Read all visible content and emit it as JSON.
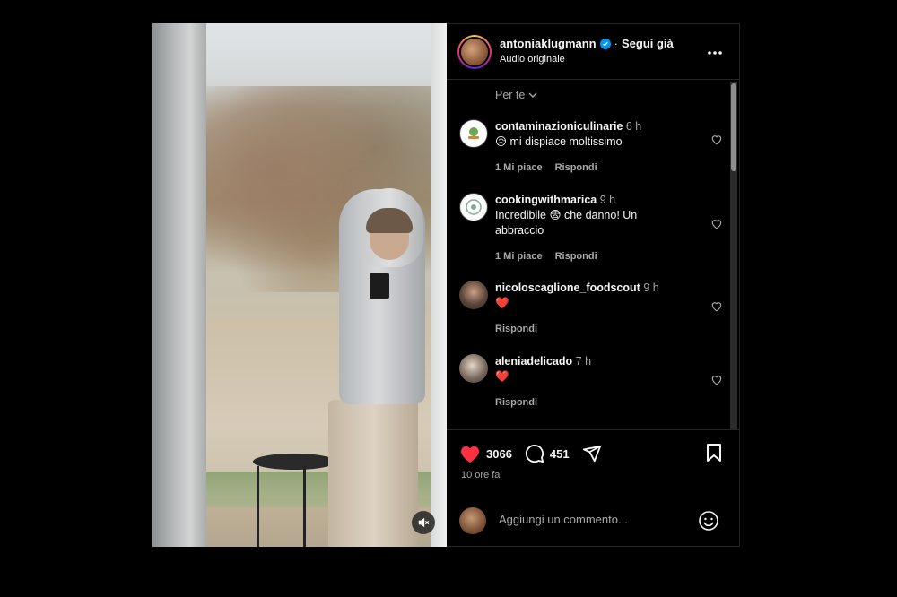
{
  "post": {
    "username": "antoniaklugmann",
    "separator": "·",
    "follow_label": "Segui già",
    "audio_label": "Audio originale"
  },
  "comments_section": {
    "sort_label": "Per te",
    "comments": [
      {
        "username": "contaminazioniculinarie",
        "time": "6 h",
        "text": "😥 mi dispiace moltissimo",
        "likes_label": "1 Mi piace",
        "reply_label": "Rispondi"
      },
      {
        "username": "cookingwithmarica",
        "time": "9 h",
        "text": "Incredibile 😨 che danno! Un abbraccio",
        "likes_label": "1 Mi piace",
        "reply_label": "Rispondi"
      },
      {
        "username": "nicoloscaglione_foodscout",
        "time": "9 h",
        "text": "❤️",
        "reply_label": "Rispondi"
      },
      {
        "username": "aleniadelicado",
        "time": "7 h",
        "text": "❤️",
        "reply_label": "Rispondi"
      }
    ]
  },
  "footer": {
    "like_count": "3066",
    "comment_count": "451",
    "time_ago": "10 ore fa",
    "add_comment_placeholder": "Aggiungi un commento..."
  },
  "colors": {
    "like_red": "#ff3040",
    "verified_blue": "#0095f6",
    "secondary_text": "#a8a8a8"
  }
}
